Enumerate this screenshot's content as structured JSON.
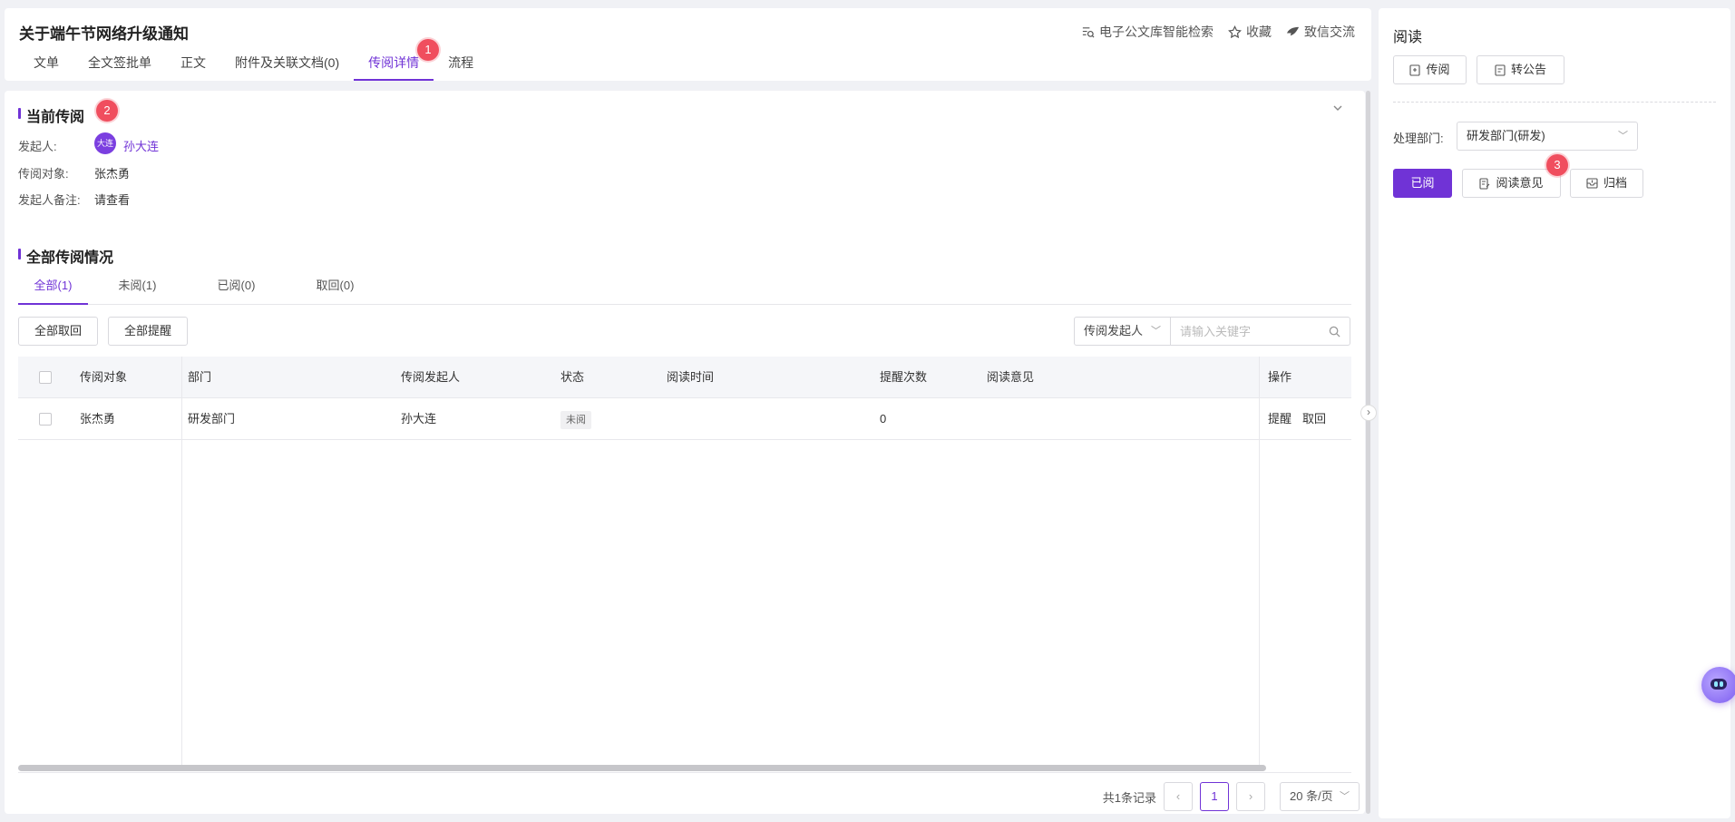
{
  "header": {
    "title": "关于端午节网络升级通知",
    "tabs": [
      {
        "label": "文单"
      },
      {
        "label": "全文签批单"
      },
      {
        "label": "正文"
      },
      {
        "label": "附件及关联文档(0)"
      },
      {
        "label": "传阅详情",
        "active": true
      },
      {
        "label": "流程"
      }
    ],
    "actions": {
      "search": "电子公文库智能检索",
      "favorite": "收藏",
      "chat": "致信交流"
    }
  },
  "markers": {
    "m1": "1",
    "m2": "2",
    "m3": "3"
  },
  "current": {
    "title": "当前传阅",
    "initiator_label": "发起人:",
    "initiator_avatar": "大连",
    "initiator_name": "孙大连",
    "target_label": "传阅对象:",
    "target_value": "张杰勇",
    "note_label": "发起人备注:",
    "note_value": "请查看"
  },
  "all": {
    "title": "全部传阅情况",
    "tabs": [
      "全部(1)",
      "未阅(1)",
      "已阅(0)",
      "取回(0)"
    ],
    "recall_all": "全部取回",
    "remind_all": "全部提醒",
    "filter_select": "传阅发起人",
    "search_placeholder": "请输入关键字"
  },
  "table": {
    "columns": [
      "传阅对象",
      "部门",
      "传阅发起人",
      "状态",
      "阅读时间",
      "提醒次数",
      "阅读意见",
      "操作"
    ],
    "rows": [
      {
        "target": "张杰勇",
        "dept": "研发部门",
        "initiator": "孙大连",
        "status": "未阅",
        "read_time": "",
        "remind_count": "0",
        "opinion": "",
        "op_remind": "提醒",
        "op_recall": "取回"
      }
    ]
  },
  "pagination": {
    "total": "共1条记录",
    "current_page": "1",
    "page_size": "20 条/页"
  },
  "right_panel": {
    "title": "阅读",
    "circulate_button": "传阅",
    "announce_button": "转公告",
    "dept_label": "处理部门:",
    "dept_value": "研发部门(研发)",
    "read_button": "已阅",
    "opinion_button": "阅读意见",
    "archive_button": "归档"
  },
  "colors": {
    "accent": "#7033d6",
    "marker": "#f04e5e"
  }
}
